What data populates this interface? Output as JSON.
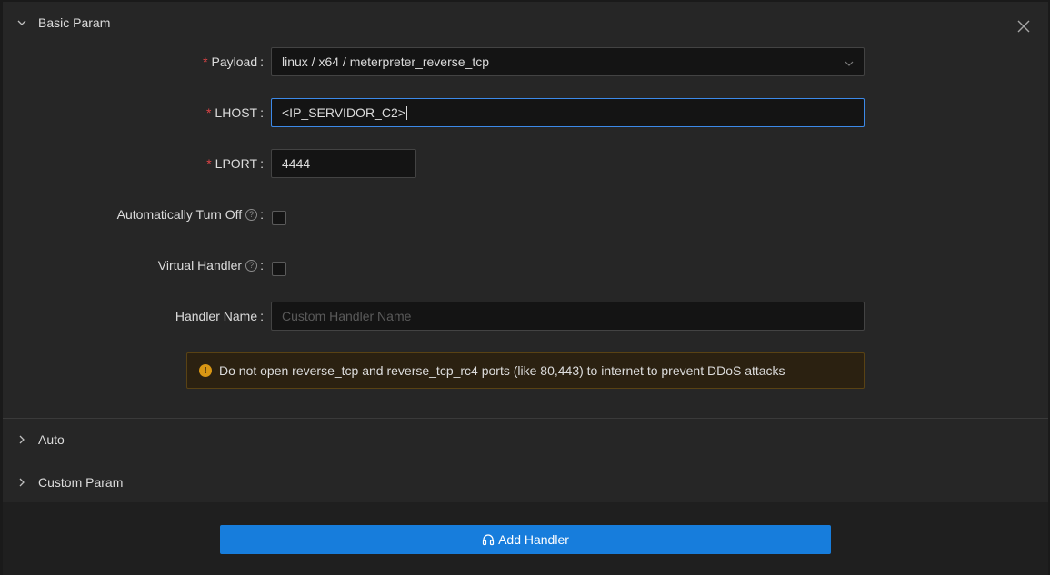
{
  "sections": {
    "basic": {
      "title": "Basic Param",
      "expanded": true
    },
    "auto": {
      "title": "Auto",
      "expanded": false
    },
    "custom": {
      "title": "Custom Param",
      "expanded": false
    }
  },
  "form": {
    "payload": {
      "label": "Payload",
      "required": true,
      "value": "linux / x64 / meterpreter_reverse_tcp"
    },
    "lhost": {
      "label": "LHOST",
      "required": true,
      "value": "<IP_SERVIDOR_C2>"
    },
    "lport": {
      "label": "LPORT",
      "required": true,
      "value": "4444"
    },
    "auto_off": {
      "label": "Automatically Turn Off",
      "checked": false
    },
    "virtual": {
      "label": "Virtual Handler",
      "checked": false
    },
    "handler_name": {
      "label": "Handler Name",
      "value": "",
      "placeholder": "Custom Handler Name"
    }
  },
  "alert": {
    "message": "Do not open reverse_tcp and reverse_tcp_rc4 ports (like 80,443) to internet to prevent DDoS attacks",
    "icon": "exclamation-circle-icon",
    "color": "#d89614"
  },
  "actions": {
    "add_handler_label": "Add Handler",
    "icon": "headset-icon",
    "color": "#177ddc"
  },
  "icons": {
    "close": "close-icon",
    "collapse_open": "chevron-down-icon",
    "collapse_closed": "chevron-right-icon",
    "help": "question-circle-icon"
  }
}
